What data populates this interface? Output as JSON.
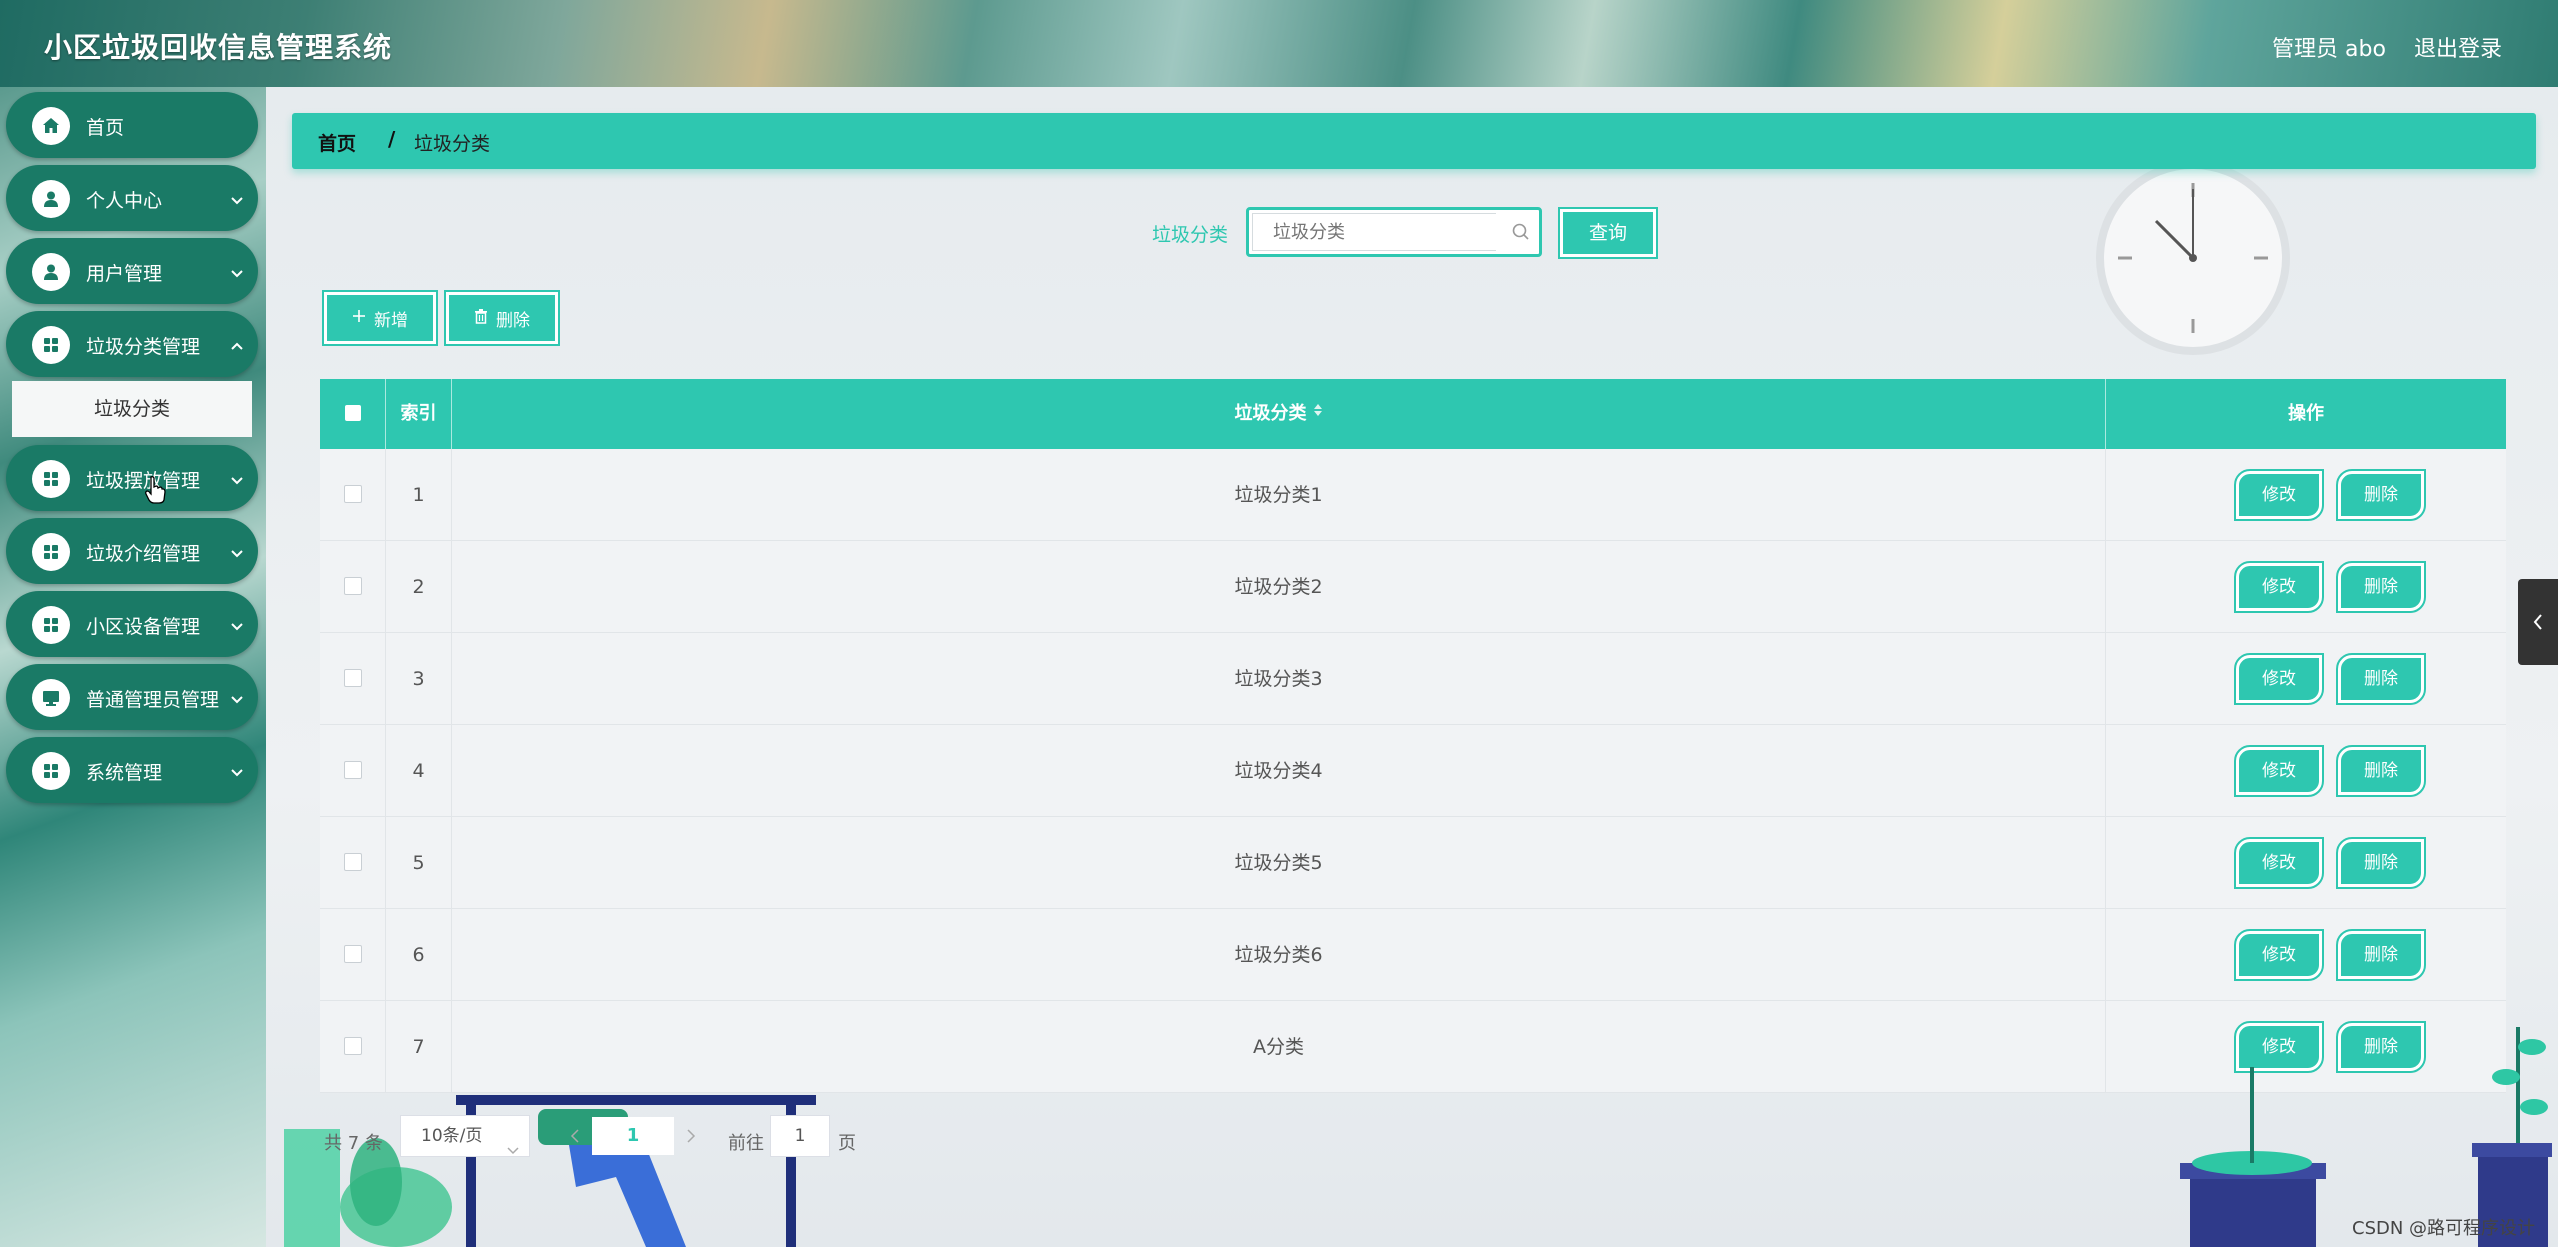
{
  "header": {
    "title": "小区垃圾回收信息管理系统",
    "admin": "管理员 abo",
    "logout": "退出登录"
  },
  "sidebar": {
    "items": [
      {
        "label": "首页",
        "icon": "home-icon"
      },
      {
        "label": "个人中心",
        "icon": "user-icon"
      },
      {
        "label": "用户管理",
        "icon": "user-icon"
      },
      {
        "label": "垃圾分类管理",
        "icon": "grid-icon"
      },
      {
        "label": "垃圾摆放管理",
        "icon": "grid-icon"
      },
      {
        "label": "垃圾介绍管理",
        "icon": "grid-icon"
      },
      {
        "label": "小区设备管理",
        "icon": "grid-icon"
      },
      {
        "label": "普通管理员管理",
        "icon": "monitor-icon"
      },
      {
        "label": "系统管理",
        "icon": "grid-icon"
      }
    ],
    "submenu": "垃圾分类"
  },
  "breadcrumb": {
    "home": "首页",
    "separator": "/",
    "current": "垃圾分类"
  },
  "search": {
    "label": "垃圾分类",
    "placeholder": "垃圾分类",
    "button": "查询"
  },
  "toolbar": {
    "add": "新增",
    "delete": "删除"
  },
  "table": {
    "columns": [
      "索引",
      "垃圾分类",
      "操作"
    ],
    "rows": [
      {
        "index": "1",
        "category": "垃圾分类1"
      },
      {
        "index": "2",
        "category": "垃圾分类2"
      },
      {
        "index": "3",
        "category": "垃圾分类3"
      },
      {
        "index": "4",
        "category": "垃圾分类4"
      },
      {
        "index": "5",
        "category": "垃圾分类5"
      },
      {
        "index": "6",
        "category": "垃圾分类6"
      },
      {
        "index": "7",
        "category": "A分类"
      }
    ],
    "edit_label": "修改",
    "delete_label": "删除"
  },
  "pagination": {
    "total": "共 7 条",
    "page_size": "10条/页",
    "current": "1",
    "goto": "前往",
    "jump_value": "1",
    "page_suffix": "页"
  },
  "watermark": "CSDN @路可程序设计",
  "colors": {
    "accent": "#2ec7b0",
    "sidebar_item": "#1a7a66"
  }
}
